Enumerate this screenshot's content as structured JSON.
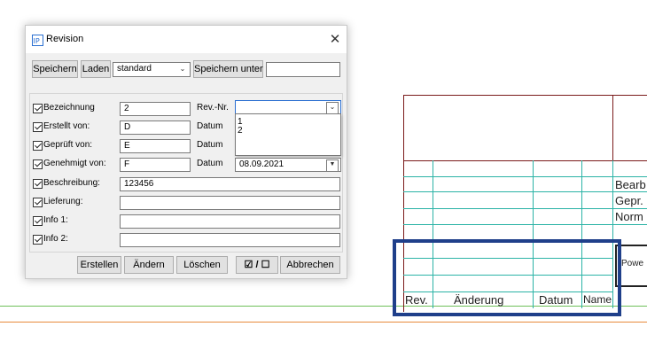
{
  "dialog": {
    "title": "Revision",
    "close_symbol": "✕",
    "toolbar": {
      "save_label": "Speichern",
      "load_label": "Laden",
      "profile_value": "standard",
      "save_as_label": "Speichern unter",
      "save_as_value": ""
    },
    "fields": [
      {
        "label": "Bezeichnung",
        "value": "2"
      },
      {
        "label": "Erstellt von:",
        "value": "D"
      },
      {
        "label": "Geprüft von:",
        "value": "E"
      },
      {
        "label": "Genehmigt von:",
        "value": "F"
      },
      {
        "label": "Beschreibung:",
        "value": "123456"
      },
      {
        "label": "Lieferung:",
        "value": ""
      },
      {
        "label": "Info 1:",
        "value": ""
      },
      {
        "label": "Info 2:",
        "value": ""
      }
    ],
    "rev_nr_label": "Rev.-Nr.",
    "rev_nr_value": "",
    "rev_nr_options": [
      "1",
      "2"
    ],
    "datum_label": "Datum",
    "datum_value": "08.09.2021",
    "buttons": {
      "create": "Erstellen",
      "change": "Ändern",
      "delete": "Löschen",
      "toggle": "☑ / ☐",
      "cancel": "Abbrechen"
    }
  },
  "drawing": {
    "title_block": {
      "rows": [
        "Bearb",
        "Gepr.",
        "Norm"
      ],
      "power_text": "Powe",
      "columns": [
        "Rev.",
        "Änderung",
        "Datum",
        "Name"
      ]
    }
  },
  "colors": {
    "highlight": "#1f3f8a",
    "frame": "#7a1a1a",
    "grid": "#2bb3a6"
  }
}
